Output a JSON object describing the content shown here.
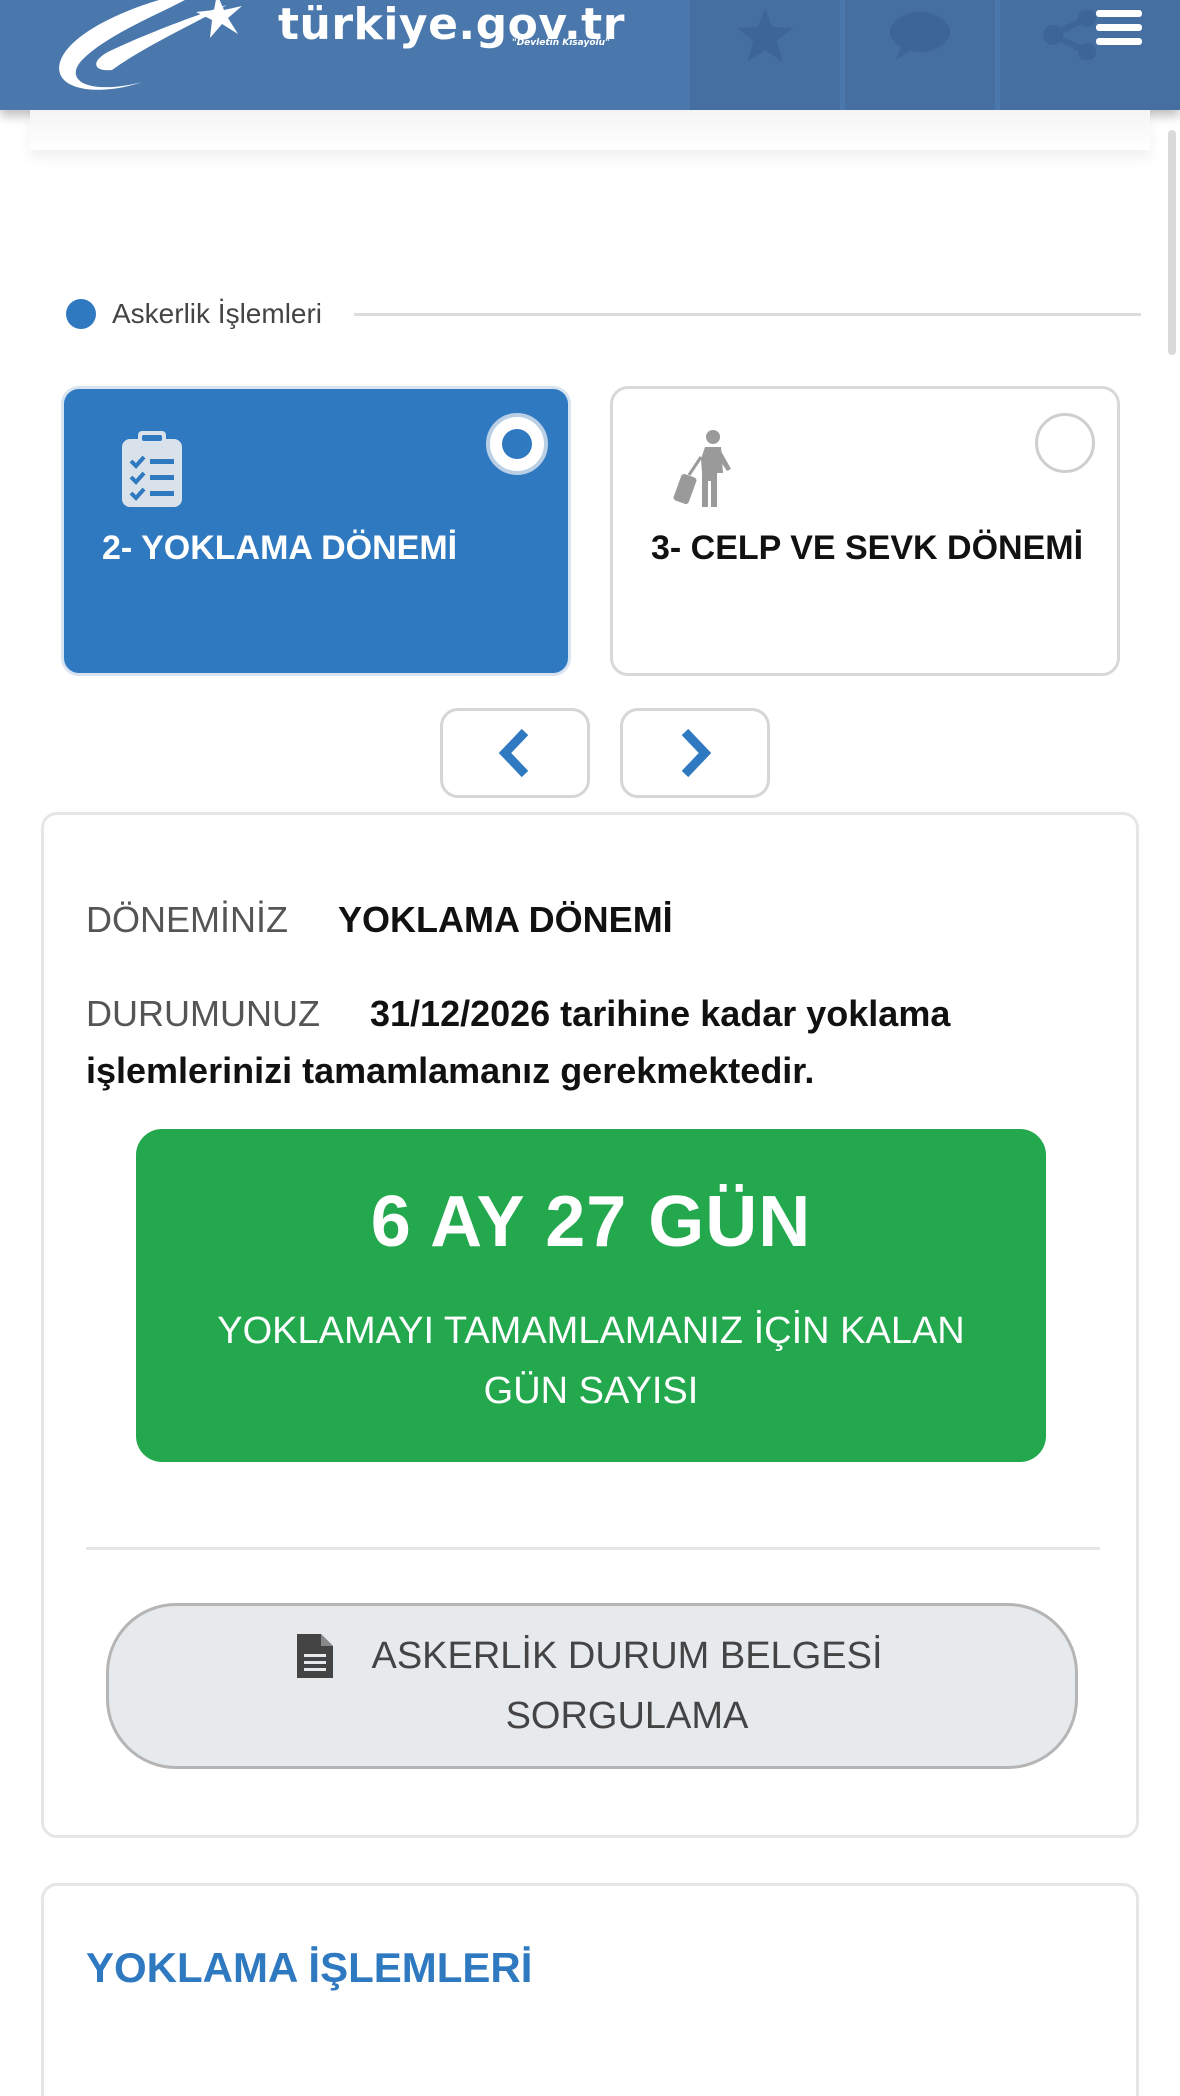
{
  "header": {
    "logo_text": "türkiye.gov.tr",
    "logo_slogan": "\"Devletin Kısayolu\"",
    "icons": [
      "star-icon",
      "chat-icon",
      "share-icon",
      "hamburger-menu-icon"
    ]
  },
  "section": {
    "label": "Askerlik İşlemleri"
  },
  "cards": [
    {
      "title": "2- YOKLAMA DÖNEMİ",
      "selected": true,
      "icon": "clipboard-checklist-icon"
    },
    {
      "title": "3- CELP VE SEVK DÖNEMİ",
      "selected": false,
      "icon": "traveler-luggage-icon"
    }
  ],
  "nav": {
    "prev_icon": "chevron-left-icon",
    "next_icon": "chevron-right-icon"
  },
  "status": {
    "period_label": "DÖNEMİNİZ",
    "period_value": "YOKLAMA DÖNEMİ",
    "status_label": "DURUMUNUZ",
    "status_value": "31/12/2026 tarihine kadar yoklama işlemlerinizi tamamlamanız gerekmektedir.",
    "countdown_value": "6 AY 27 GÜN",
    "countdown_caption": "YOKLAMAYI TAMAMLAMANIZ İÇİN KALAN GÜN SAYISI"
  },
  "document_button": {
    "label": "ASKERLİK DURUM BELGESİ SORGULAMA",
    "icon": "document-icon"
  },
  "panel2": {
    "title": "YOKLAMA İŞLEMLERİ"
  },
  "colors": {
    "header_blue": "#4a78ad",
    "accent_blue": "#2f79c1",
    "success_green": "#23a84e"
  }
}
